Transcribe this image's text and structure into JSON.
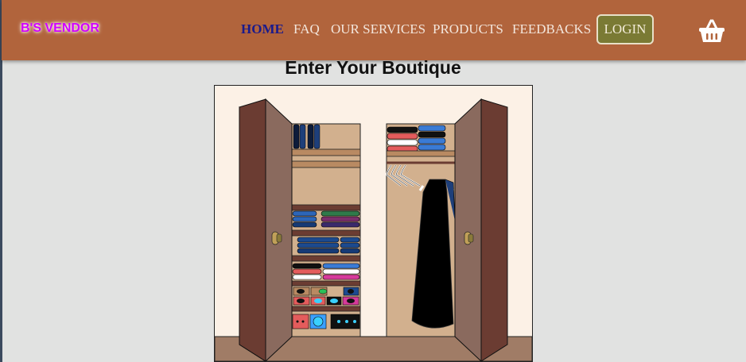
{
  "brand": {
    "name": "B'S VENDOR"
  },
  "nav": {
    "items": [
      {
        "label": "HOME",
        "active": true
      },
      {
        "label": "FAQ",
        "active": false
      },
      {
        "label": "OUR SERVICES",
        "active": false
      },
      {
        "label": "PRODUCTS",
        "active": false
      },
      {
        "label": "FEEDBACKS",
        "active": false
      }
    ],
    "login_label": "LOGIN",
    "cart_icon": "basket-icon"
  },
  "hero": {
    "title": "Enter Your Boutique",
    "image": "closet-illustration"
  },
  "colors": {
    "navbar": "#b1643c",
    "brand": "#d100ff",
    "active_link": "#1a1a8c",
    "login_button": "#7a7a34",
    "page_background": "#e1e2e1",
    "closet_wall": "#fcf1e6",
    "door": "#6b3c32",
    "shelf": "#c49a78"
  }
}
